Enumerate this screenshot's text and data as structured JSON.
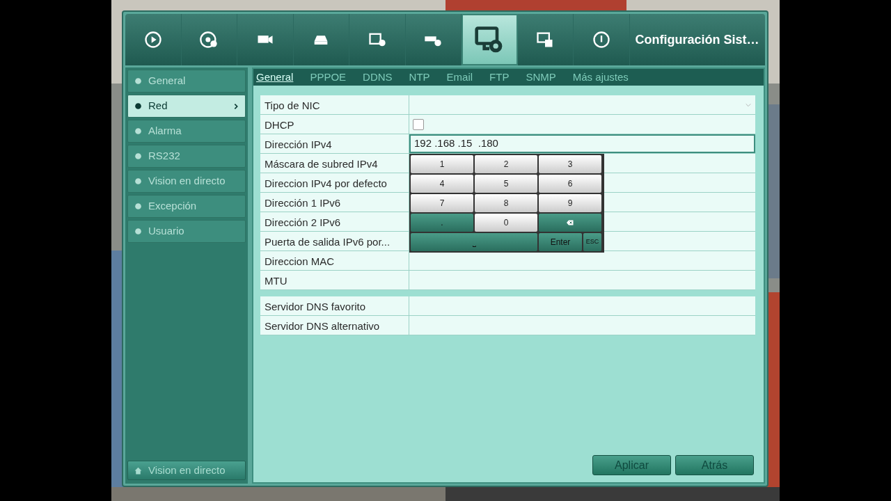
{
  "top_menu": {
    "icons": [
      {
        "selected": false
      },
      {
        "selected": false
      },
      {
        "selected": false
      },
      {
        "selected": false
      },
      {
        "selected": false
      },
      {
        "selected": false
      },
      {
        "selected": true
      },
      {
        "selected": false
      },
      {
        "selected": false
      }
    ],
    "title": "Configuración Sist…"
  },
  "sidebar": {
    "items": [
      {
        "label": "General",
        "selected": false
      },
      {
        "label": "Red",
        "selected": true
      },
      {
        "label": "Alarma",
        "selected": false
      },
      {
        "label": "RS232",
        "selected": false
      },
      {
        "label": "Vision en directo",
        "selected": false
      },
      {
        "label": "Excepción",
        "selected": false
      },
      {
        "label": "Usuario",
        "selected": false
      }
    ],
    "footer_button": "Vision en directo"
  },
  "tabs": [
    {
      "label": "General",
      "selected": true
    },
    {
      "label": "PPPOE",
      "selected": false
    },
    {
      "label": "DDNS",
      "selected": false
    },
    {
      "label": "NTP",
      "selected": false
    },
    {
      "label": "Email",
      "selected": false
    },
    {
      "label": "FTP",
      "selected": false
    },
    {
      "label": "SNMP",
      "selected": false
    },
    {
      "label": "Más ajustes",
      "selected": false
    }
  ],
  "form_groups": [
    [
      {
        "label": "Tipo de NIC",
        "kind": "select"
      },
      {
        "label": "DHCP",
        "kind": "checkbox",
        "checked": false
      },
      {
        "label": "Dirección IPv4",
        "kind": "input",
        "value": "192 .168 .15  .180"
      },
      {
        "label": "Máscara de subred IPv4",
        "kind": "text"
      },
      {
        "label": "Direccion IPv4 por defecto",
        "kind": "text"
      },
      {
        "label": "Dirección 1 IPv6",
        "kind": "text"
      },
      {
        "label": "Dirección 2 IPv6",
        "kind": "text"
      },
      {
        "label": "Puerta de salida IPv6 por...",
        "kind": "text"
      },
      {
        "label": "Direccion MAC",
        "kind": "text"
      },
      {
        "label": "MTU",
        "kind": "text"
      }
    ],
    [
      {
        "label": "Servidor DNS favorito",
        "kind": "text"
      },
      {
        "label": "Servidor DNS alternativo",
        "kind": "text"
      }
    ]
  ],
  "keypad": [
    {
      "label": "1",
      "kind": "light"
    },
    {
      "label": "2",
      "kind": "light"
    },
    {
      "label": "3",
      "kind": "light"
    },
    {
      "label": "4",
      "kind": "light"
    },
    {
      "label": "5",
      "kind": "light"
    },
    {
      "label": "6",
      "kind": "light"
    },
    {
      "label": "7",
      "kind": "light"
    },
    {
      "label": "8",
      "kind": "light"
    },
    {
      "label": "9",
      "kind": "light"
    },
    {
      "label": ".",
      "kind": "dark"
    },
    {
      "label": "0",
      "kind": "light"
    },
    {
      "kind": "backspace"
    },
    {
      "label": "⎵",
      "kind": "space"
    },
    {
      "label": "Enter",
      "kind": "enter"
    },
    {
      "label": "ESC",
      "kind": "esc"
    }
  ],
  "buttons": [
    "Aplicar",
    "Atrás"
  ]
}
